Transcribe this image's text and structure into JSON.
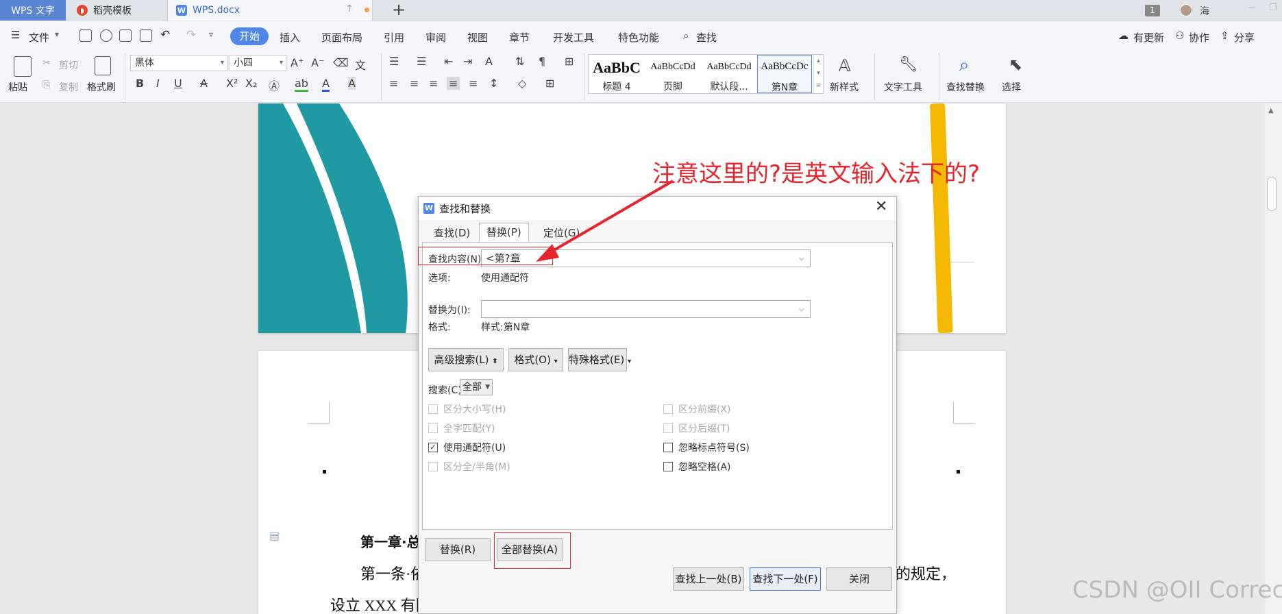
{
  "tabs": {
    "app": "WPS 文字",
    "template": "稻壳模板",
    "document": "WPS.docx",
    "window_count": "1",
    "user": "海"
  },
  "menu": {
    "file": "文件",
    "start": "开始",
    "items": [
      "插入",
      "页面布局",
      "引用",
      "审阅",
      "视图",
      "章节",
      "开发工具",
      "特色功能"
    ],
    "search": "查找",
    "update": "有更新",
    "collab": "协作",
    "share": "分享"
  },
  "ribbon": {
    "paste": "粘贴",
    "cut": "剪切",
    "copy": "复制",
    "format_painter": "格式刷",
    "font_name": "黑体",
    "font_size": "小四",
    "styles": [
      {
        "preview": "AaBbC",
        "name": "标题 4"
      },
      {
        "preview": "AaBbCcDd",
        "name": "页脚"
      },
      {
        "preview": "AaBbCcDd",
        "name": "默认段..."
      },
      {
        "preview": "AaBbCcDc",
        "name": "第N章"
      }
    ],
    "new_style": "新样式",
    "text_tools": "文字工具",
    "find_replace": "查找替换",
    "select": "选择"
  },
  "annotation": "注意这里的?是英文输入法下的?",
  "document": {
    "heading": "第一章·总",
    "para1_start": "第一条·依",
    "para1_end": "的规定，",
    "para2": "设立 XXX 有限公司（以下简称公司），特制定本章程。↵"
  },
  "watermark": "CSDN @OII Correct",
  "dialog": {
    "title": "查找和替换",
    "tabs": [
      "查找(D)",
      "替换(P)",
      "定位(G)"
    ],
    "find_label": "查找内容(N):",
    "find_value": "<第?章",
    "options_label": "选项:",
    "options_value": "使用通配符",
    "replace_label": "替换为(I):",
    "replace_value": "",
    "format_label": "格式:",
    "format_value": "样式:第N章",
    "advanced": "高级搜索(L)",
    "format_btn": "格式(O)",
    "special_btn": "特殊格式(E)",
    "search_label": "搜索(C)",
    "search_scope": "全部",
    "checks_left": [
      {
        "label": "区分大小写(H)",
        "checked": false,
        "enabled": false
      },
      {
        "label": "全字匹配(Y)",
        "checked": false,
        "enabled": false
      },
      {
        "label": "使用通配符(U)",
        "checked": true,
        "enabled": true
      },
      {
        "label": "区分全/半角(M)",
        "checked": false,
        "enabled": false
      }
    ],
    "checks_right": [
      {
        "label": "区分前缀(X)",
        "checked": false,
        "enabled": false
      },
      {
        "label": "区分后缀(T)",
        "checked": false,
        "enabled": false
      },
      {
        "label": "忽略标点符号(S)",
        "checked": false,
        "enabled": true
      },
      {
        "label": "忽略空格(A)",
        "checked": false,
        "enabled": true
      }
    ],
    "replace_btn": "替换(R)",
    "replace_all_btn": "全部替换(A)",
    "find_prev": "查找上一处(B)",
    "find_next": "查找下一处(F)",
    "close_btn": "关闭"
  },
  "colors": {
    "accent": "#4f86e8",
    "teal": "#1f9aa3",
    "yellow": "#f5b800",
    "annotation_red": "#e5242b"
  }
}
